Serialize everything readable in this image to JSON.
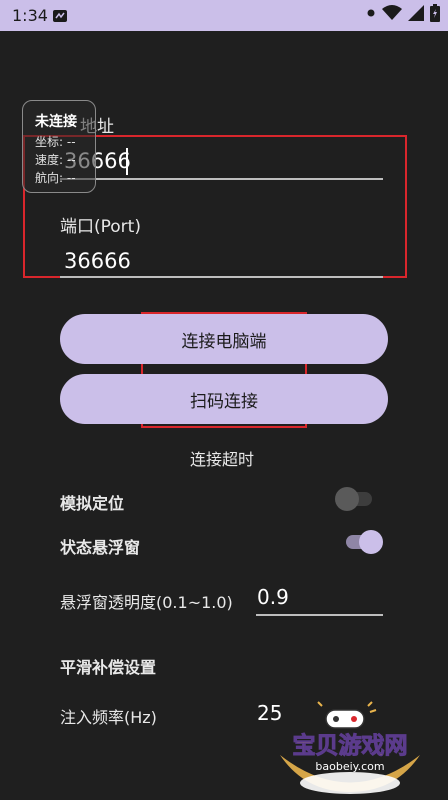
{
  "status_bar": {
    "time": "1:34"
  },
  "form": {
    "ip_label": "地址",
    "ip_value": "36666",
    "port_label": "端口(Port)",
    "port_value": "36666"
  },
  "buttons": {
    "connect_pc": "连接电脑端",
    "scan_connect": "扫码连接"
  },
  "status_text": "连接超时",
  "settings": {
    "mock_location_label": "模拟定位",
    "mock_location_on": false,
    "floating_window_label": "状态悬浮窗",
    "floating_window_on": true,
    "opacity_label": "悬浮窗透明度(0.1~1.0)",
    "opacity_value": "0.9",
    "smoothing_title": "平滑补偿设置",
    "injection_rate_label": "注入频率(Hz)",
    "injection_rate_value": "25"
  },
  "floating_window": {
    "title": "未连接",
    "coords": "坐标: --",
    "speed": "速度: --",
    "heading": "航向: --"
  },
  "watermark": {
    "text": "宝贝游戏网",
    "url": "baobeiy.com"
  },
  "colors": {
    "accent": "#cbbfe9",
    "background": "#1f1f1f",
    "highlight_border": "#d9262c"
  }
}
